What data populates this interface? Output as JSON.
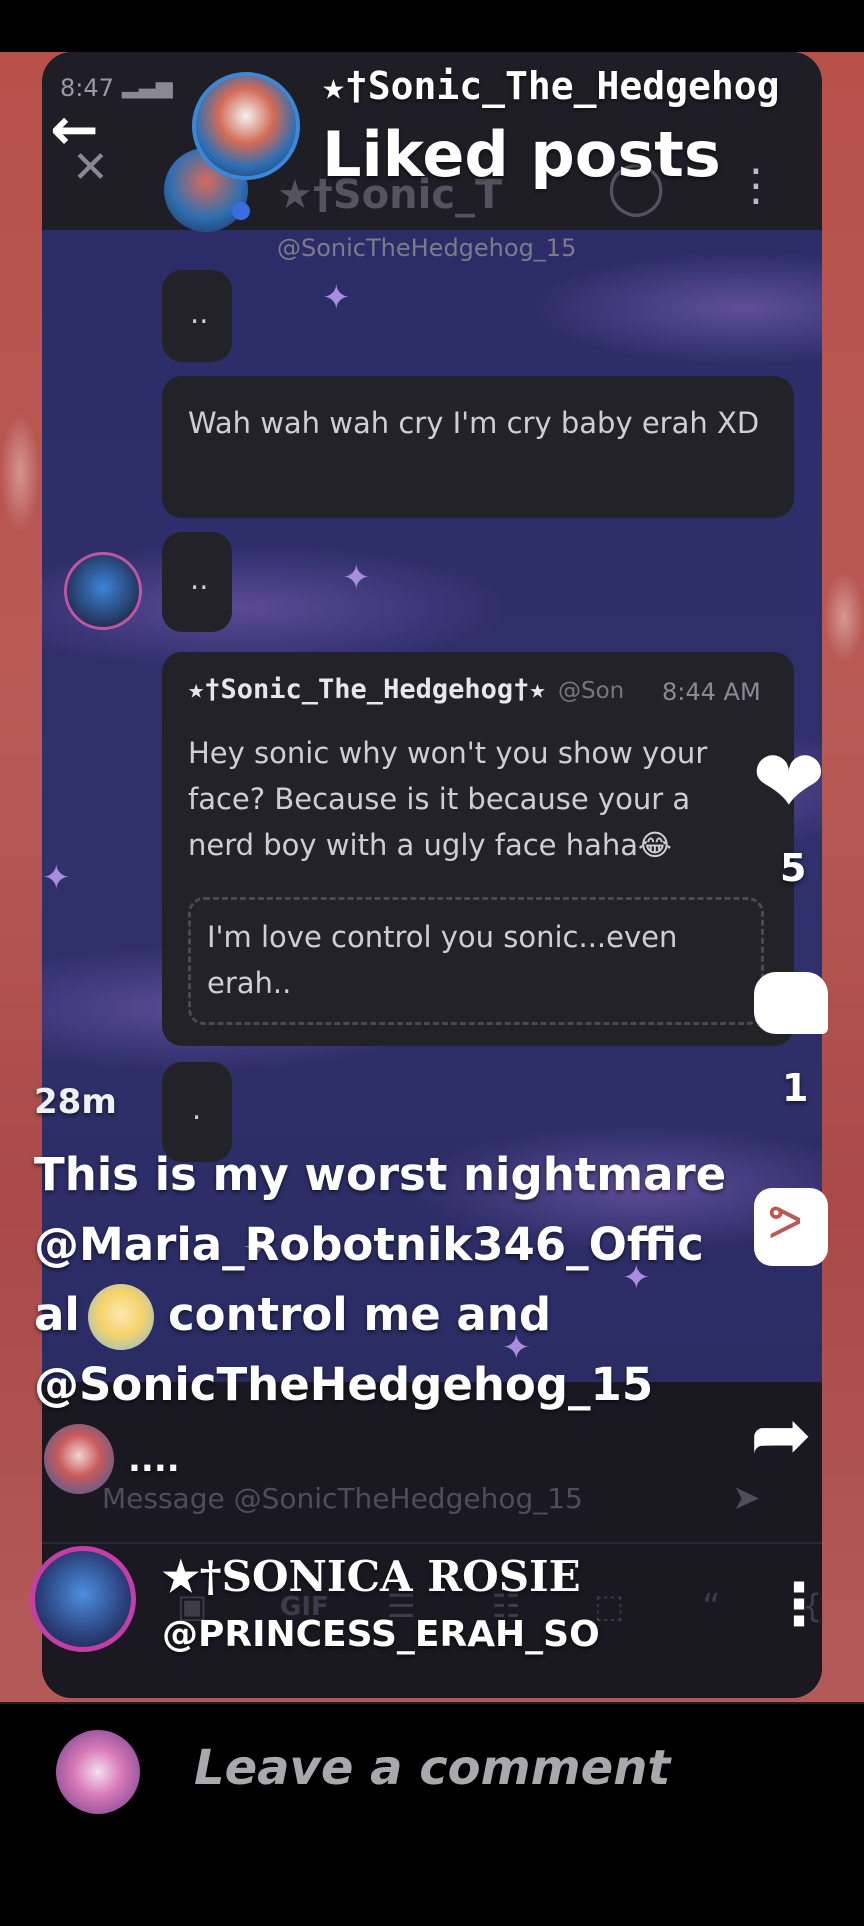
{
  "status_bar": {
    "time": "8:47"
  },
  "header": {
    "title": "Liked posts",
    "author_name": "★†Sonic_The_Hedgehog",
    "back_icon": "arrow-left-icon"
  },
  "embedded_chat": {
    "channel_name": "★†Sonic_T",
    "channel_handle": "@SonicTheHedgehog_15",
    "messages": [
      {
        "text": ".."
      },
      {
        "text": "Wah wah wah cry I'm cry baby erah XD"
      },
      {
        "text": ".."
      },
      {
        "author": "★†Sonic_The_Hedgehog†★",
        "handle": "@Son",
        "time": "8:44 AM",
        "text": "Hey sonic why won't you show your face? Because is it because your a nerd boy with a ugly face haha😂",
        "quote": "I'm love control you sonic...even erah.."
      },
      {
        "text": "."
      }
    ],
    "input_placeholder": "Message @SonicTheHedgehog_15",
    "typing": "....",
    "toolbar_gif": "GIF",
    "toolbar_quote": "“"
  },
  "post": {
    "age": "28m",
    "caption_line1": "This is my worst nightmare",
    "caption_line2": "@Maria_Robotnik346_Offic",
    "caption_line3a": "al",
    "caption_line3b": "control me and",
    "caption_line4": "@SonicTheHedgehog_15",
    "author_display": "★†SONICA ROSIE",
    "author_handle": "@PRINCESS_ERAH_SO"
  },
  "actions": {
    "likes": "5",
    "comments": "1",
    "like_icon": "heart-icon",
    "comment_icon": "speech-bubble-icon",
    "remix_icon": "remix-icon",
    "share_icon": "share-arrow-icon"
  },
  "comment_bar": {
    "placeholder": "Leave a comment"
  }
}
